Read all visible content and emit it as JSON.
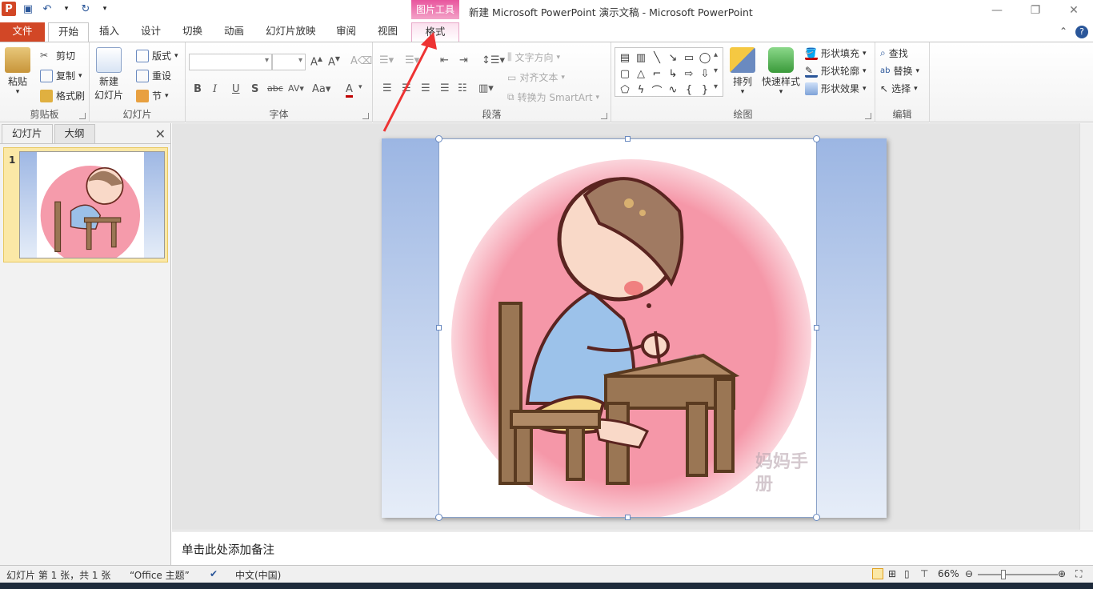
{
  "window": {
    "title": "新建 Microsoft PowerPoint 演示文稿 - Microsoft PowerPoint",
    "context_tab_header": "图片工具"
  },
  "tabs": [
    {
      "label": "文件"
    },
    {
      "label": "开始"
    },
    {
      "label": "插入"
    },
    {
      "label": "设计"
    },
    {
      "label": "切换"
    },
    {
      "label": "动画"
    },
    {
      "label": "幻灯片放映"
    },
    {
      "label": "审阅"
    },
    {
      "label": "视图"
    },
    {
      "label": "格式"
    }
  ],
  "ribbon": {
    "clipboard": {
      "label": "剪贴板",
      "paste": "粘贴",
      "cut": "剪切",
      "copy": "复制",
      "format_painter": "格式刷"
    },
    "slides": {
      "label": "幻灯片",
      "new_slide_1": "新建",
      "new_slide_2": "幻灯片",
      "layout": "版式",
      "reset": "重设",
      "section": "节"
    },
    "font": {
      "label": "字体"
    },
    "paragraph": {
      "label": "段落",
      "text_direction": "文字方向",
      "align_text": "对齐文本",
      "smartart": "转换为 SmartArt"
    },
    "drawing": {
      "label": "绘图",
      "arrange": "排列",
      "quick_styles": "快速样式",
      "shape_fill": "形状填充",
      "shape_outline": "形状轮廓",
      "shape_effects": "形状效果"
    },
    "editing": {
      "label": "编辑",
      "find": "查找",
      "replace": "替换",
      "select": "选择"
    }
  },
  "left_pane": {
    "tab_slides": "幻灯片",
    "tab_outline": "大纲",
    "close": "✕",
    "slide_number": "1"
  },
  "notes": {
    "placeholder": "单击此处添加备注"
  },
  "status": {
    "slide_info": "幻灯片 第 1 张，共 1 张",
    "theme": "“Office 主题”",
    "language": "中文(中国)",
    "zoom": "66%"
  },
  "watermark": "妈妈手册",
  "colors": {
    "file_tab": "#d24726",
    "context_tab": "#e8559d",
    "annotation_arrow": "#ee3333"
  }
}
